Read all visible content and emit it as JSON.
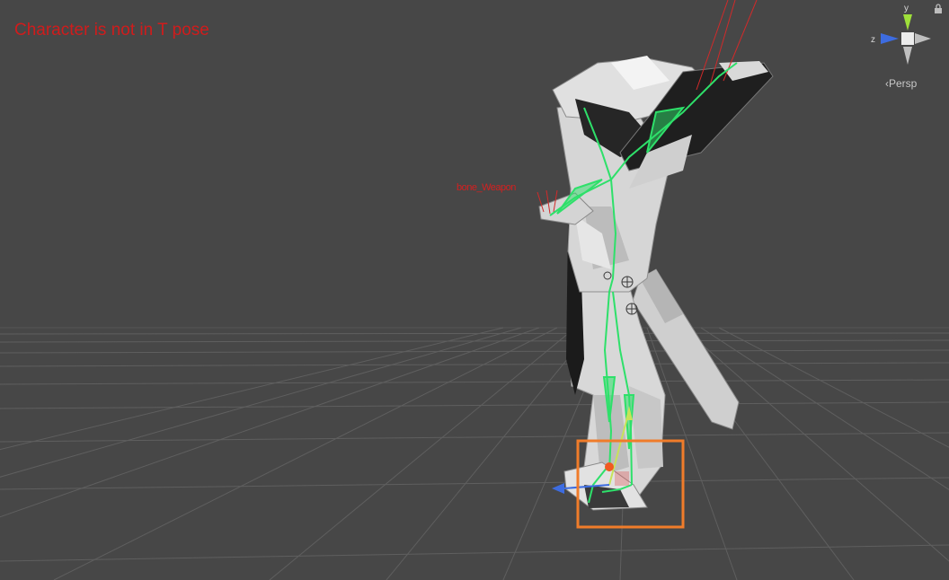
{
  "viewport": {
    "warning_text": "Character is not in T pose",
    "projection_label": "Persp",
    "bone_label": "bone_Weapon",
    "highlight_color": "#f07c2a",
    "warning_color": "#d01c1c",
    "bone_color": "#2ee06a"
  },
  "gizmo": {
    "axis_y": "y",
    "axis_z": "z"
  },
  "icons": [
    "lock-icon",
    "orientation-gizmo-icon",
    "perspective-chevron-icon"
  ]
}
